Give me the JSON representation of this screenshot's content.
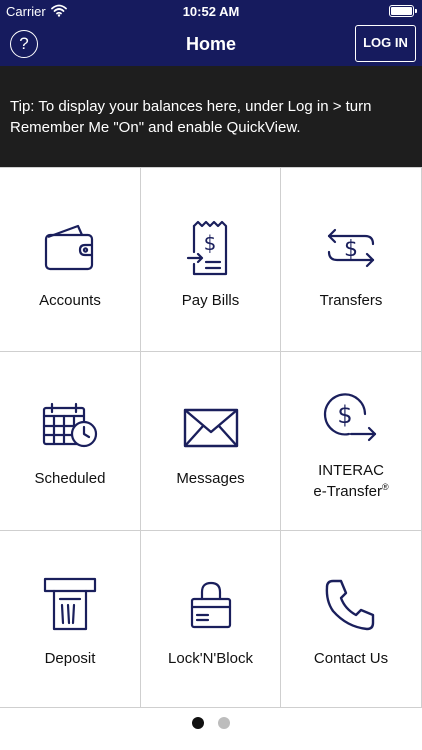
{
  "status_bar": {
    "carrier": "Carrier",
    "time": "10:52 AM",
    "wifi_icon": "wifi-icon",
    "battery_icon": "battery-icon"
  },
  "nav_bar": {
    "help_label": "?",
    "title": "Home",
    "login_label": "LOG IN"
  },
  "tip": {
    "text": "Tip: To display your balances here, under Log in > turn Remember Me \"On\" and enable QuickView."
  },
  "tiles": {
    "accounts": {
      "label": "Accounts",
      "icon": "wallet-icon"
    },
    "pay_bills": {
      "label": "Pay Bills",
      "icon": "bill-receipt-icon"
    },
    "transfers": {
      "label": "Transfers",
      "icon": "transfer-arrows-icon"
    },
    "scheduled": {
      "label": "Scheduled",
      "icon": "calendar-clock-icon"
    },
    "messages": {
      "label": "Messages",
      "icon": "envelope-icon"
    },
    "interac": {
      "line1": "INTERAC",
      "line2": "e-Transfer",
      "mark": "®",
      "icon": "dollar-send-icon"
    },
    "deposit": {
      "label": "Deposit",
      "icon": "atm-cheque-icon"
    },
    "lock_n_block": {
      "label": "Lock'N'Block",
      "icon": "padlock-card-icon"
    },
    "contact_us": {
      "label": "Contact Us",
      "icon": "phone-icon"
    }
  },
  "pager": {
    "page": 1,
    "total": 2
  },
  "colors": {
    "brand_navy": "#161b5e",
    "tip_background": "#1e1e1e",
    "icon_color": "#1a1f5c",
    "divider": "#cfcfcf"
  }
}
